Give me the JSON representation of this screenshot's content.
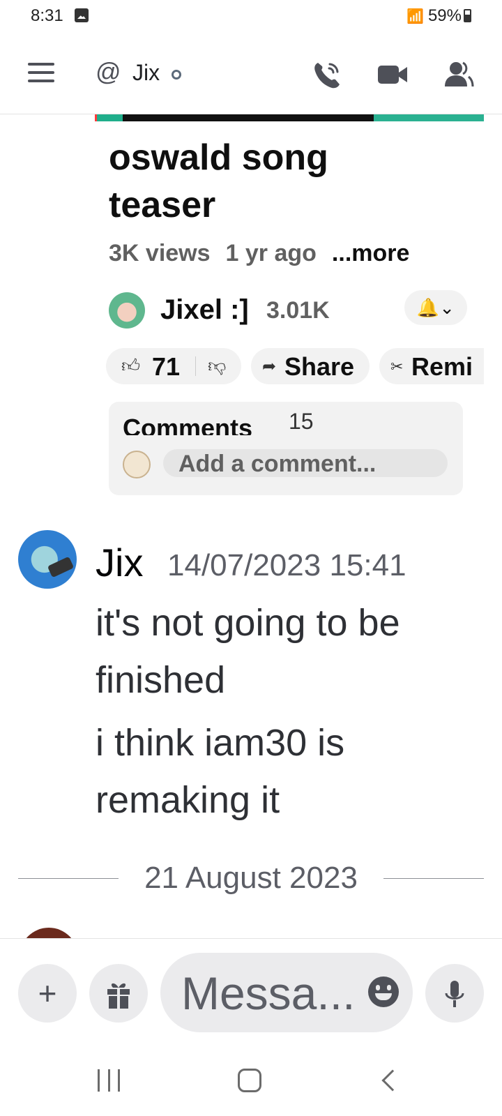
{
  "status_bar": {
    "time": "8:31",
    "battery": "59%"
  },
  "header": {
    "channel_prefix": "@",
    "channel_name": "Jix"
  },
  "embed": {
    "video_title": "oswald song teaser",
    "views": "3K views",
    "age": "1 yr ago",
    "more": "...more",
    "channel": "Jixel :]",
    "subscribers": "3.01K",
    "likes": "71",
    "share_label": "Share",
    "remix_label": "Remi",
    "comments_label": "Comments",
    "comments_count": "15",
    "add_comment_placeholder": "Add a comment..."
  },
  "message": {
    "author": "Jix",
    "timestamp": "14/07/2023 15:41",
    "lines": [
      "it's not going to be finished",
      "i think iam30 is remaking it"
    ]
  },
  "divider": {
    "date": "21 August 2023"
  },
  "composer": {
    "placeholder": "Messa..."
  },
  "colors": {
    "accent_text": "#1e1f22",
    "muted_text": "#5c5e66",
    "button_bg": "#ebebed"
  }
}
